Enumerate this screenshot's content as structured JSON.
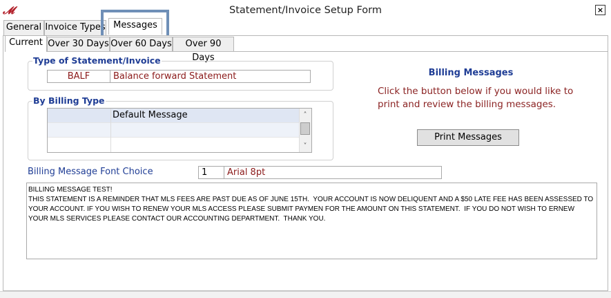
{
  "window": {
    "title": "Statement/Invoice Setup Form",
    "close_label": "×",
    "logo_label": "𝓜"
  },
  "main_tabs": [
    {
      "label": "General",
      "active": false
    },
    {
      "label": "Invoice Types",
      "active": false
    },
    {
      "label": "Messages",
      "active": true
    }
  ],
  "sub_tabs": [
    {
      "label": "Current",
      "active": true
    },
    {
      "label": "Over 30 Days",
      "active": false
    },
    {
      "label": "Over 60 Days",
      "active": false
    },
    {
      "label": "Over 90 Days",
      "active": false
    }
  ],
  "statement_type": {
    "title": "Type of Statement/Invoice",
    "code": "BALF",
    "description": "Balance forward Statement"
  },
  "billing_type": {
    "title": "By Billing Type",
    "rows": [
      {
        "col1": "",
        "col2": "Default Message",
        "selected": true
      },
      {
        "col1": "",
        "col2": "",
        "selected": false
      },
      {
        "col1": "",
        "col2": "",
        "selected": false
      }
    ]
  },
  "billing_messages": {
    "title": "Billing Messages",
    "instructions": "Click the button below if you would like to print and review the billing messages.",
    "print_button": "Print Messages"
  },
  "font_choice": {
    "label": "Billing Message Font Choice",
    "number": "1",
    "name": "Arial 8pt"
  },
  "message": {
    "text": "BILLING MESSAGE TEST!\nTHIS STATEMENT IS A REMINDER THAT MLS FEES ARE PAST DUE AS OF JUNE 15TH.  YOUR ACCOUNT IS NOW DELIQUENT AND A $50 LATE FEE HAS BEEN ASSESSED TO YOUR ACCOUNT. IF YOU WISH TO RENEW YOUR MLS ACCESS PLEASE SUBMIT PAYMEN FOR THE AMOUNT ON THIS STATEMENT.  IF YOU DO NOT WISH TO ERNEW YOUR MLS SERVICES PLEASE CONTACT OUR ACCOUNTING DEPARTMENT.  THANK YOU."
  },
  "colors": {
    "heading_blue": "#1f3d95",
    "value_red": "#8b1a1a",
    "tab_highlight": "#6f8fb7"
  }
}
